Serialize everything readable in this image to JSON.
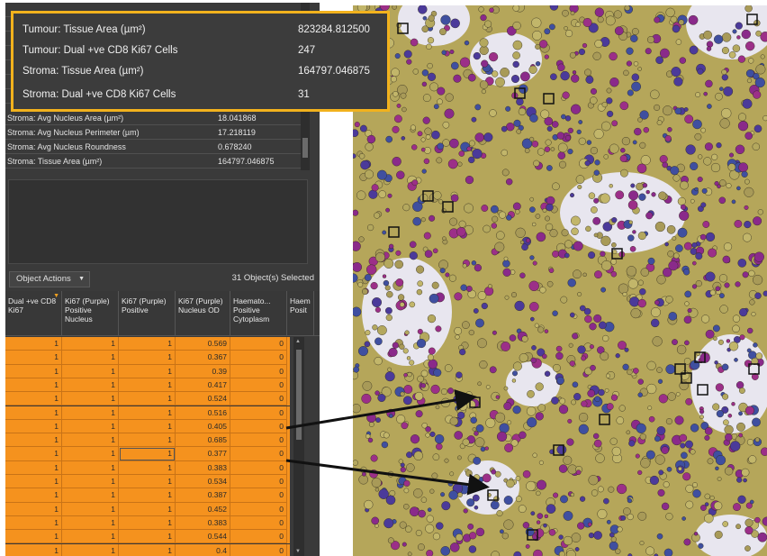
{
  "tooltip": {
    "rows": [
      {
        "label": "Tumour: Tissue Area (µm²)",
        "value": "823284.812500"
      },
      {
        "label": "Tumour: Dual +ve CD8 Ki67 Cells",
        "value": "247"
      },
      {
        "label": "Stroma: Tissue Area (µm²)",
        "value": "164797.046875"
      },
      {
        "label": "Stroma: Dual +ve CD8 Ki67 Cells",
        "value": "31"
      }
    ]
  },
  "measurements": [
    {
      "name": "Stroma: Avg Nucleus Area (µm²)",
      "value": "18.041868"
    },
    {
      "name": "Stroma: Avg Nucleus Perimeter (µm)",
      "value": "17.218119"
    },
    {
      "name": "Stroma: Avg Nucleus Roundness",
      "value": "0.678240"
    },
    {
      "name": "Stroma: Tissue Area (µm²)",
      "value": "164797.046875"
    }
  ],
  "toolbar": {
    "object_actions_label": "Object Actions",
    "selected_count": "31 Object(s) Selected"
  },
  "table": {
    "headers": [
      "Dual +ve CD8 Ki67",
      "Ki67 (Purple) Positive Nucleus",
      "Ki67 (Purple) Positive",
      "Ki67 (Purple) Nucleus OD",
      "Haemato... Positive Cytoplasm",
      "Haem Posit"
    ],
    "rows": [
      [
        "1",
        "1",
        "1",
        "0.569",
        "0"
      ],
      [
        "1",
        "1",
        "1",
        "0.367",
        "0"
      ],
      [
        "1",
        "1",
        "1",
        "0.39",
        "0"
      ],
      [
        "1",
        "1",
        "1",
        "0.417",
        "0"
      ],
      [
        "1",
        "1",
        "1",
        "0.524",
        "0"
      ],
      [
        "1",
        "1",
        "1",
        "0.516",
        "0"
      ],
      [
        "1",
        "1",
        "1",
        "0.405",
        "0"
      ],
      [
        "1",
        "1",
        "1",
        "0.685",
        "0"
      ],
      [
        "1",
        "1",
        "1",
        "0.377",
        "0"
      ],
      [
        "1",
        "1",
        "1",
        "0.383",
        "0"
      ],
      [
        "1",
        "1",
        "1",
        "0.534",
        "0"
      ],
      [
        "1",
        "1",
        "1",
        "0.387",
        "0"
      ],
      [
        "1",
        "1",
        "1",
        "0.452",
        "0"
      ],
      [
        "1",
        "1",
        "1",
        "0.383",
        "0"
      ],
      [
        "1",
        "1",
        "1",
        "0.544",
        "0"
      ],
      [
        "1",
        "1",
        "1",
        "0.4",
        "0"
      ]
    ]
  },
  "colors": {
    "tooltip_border": "#f2b21d",
    "row_highlight": "#f5921e",
    "panel_bg": "#3a3a3a"
  }
}
